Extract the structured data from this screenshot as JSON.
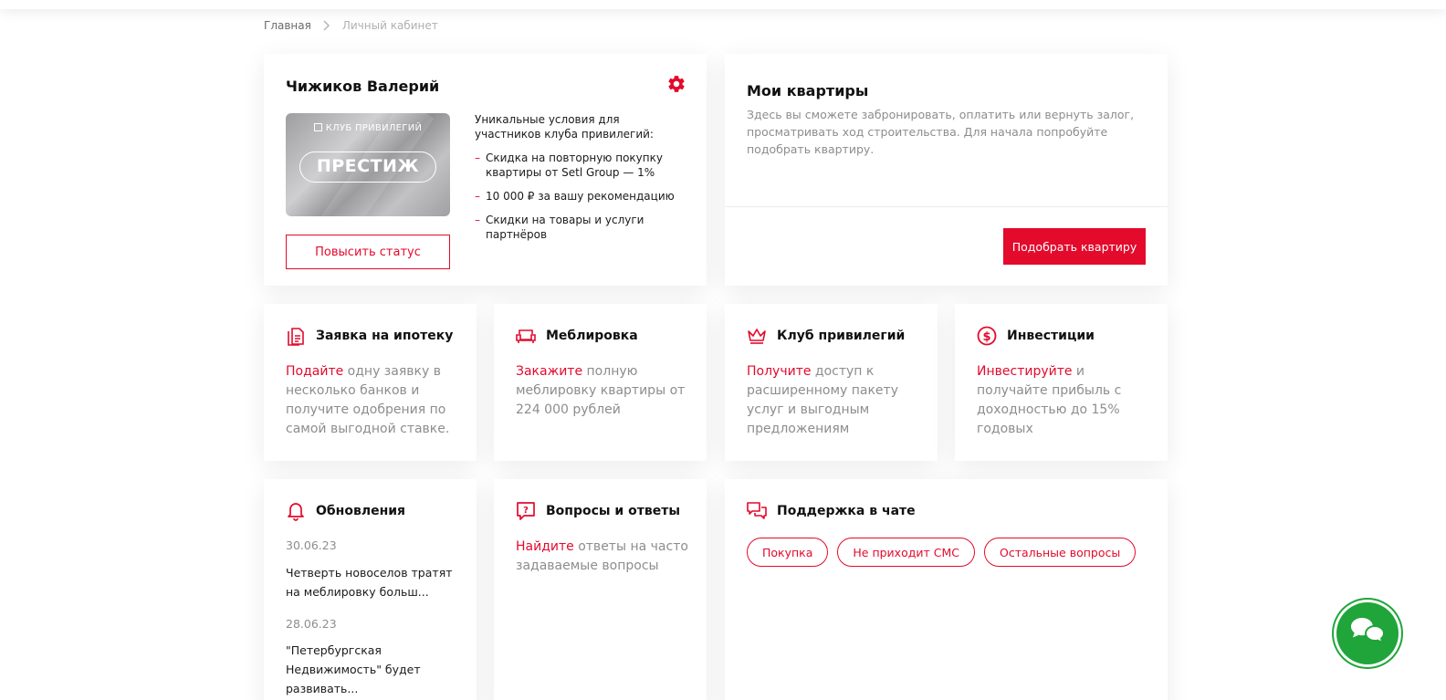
{
  "breadcrumb": {
    "home": "Главная",
    "current": "Личный кабинет"
  },
  "profile": {
    "name": "Чижиков Валерий",
    "card_club": "КЛУБ ПРИВИЛЕГИЙ",
    "card_status": "ПРЕСТИЖ",
    "upgrade_button": "Повысить статус",
    "benefits_intro": "Уникальные условия для участников клуба привилегий:",
    "benefits": [
      "Скидка на повторную покупку квартиры от Setl Group — 1%",
      "10 000 ₽ за вашу рекомендацию",
      "Скидки на товары и услуги партнёров"
    ]
  },
  "apartments": {
    "title": "Мои квартиры",
    "description": "Здесь вы сможете забронировать, оплатить или вернуть залог, просматривать ход строительства. Для начала попробуйте подобрать квартиру.",
    "button": "Подобрать квартиру"
  },
  "services": [
    {
      "title": "Заявка на ипотеку",
      "link": "Подайте",
      "text": " одну заявку в несколько банков и получите одобрения по самой выгодной ставке.",
      "icon": "document-icon"
    },
    {
      "title": "Меблировка",
      "link": "Закажите",
      "text": " полную меблировку квартиры от 224 000 рублей",
      "icon": "sofa-icon"
    },
    {
      "title": "Клуб привилегий",
      "link": "Получите",
      "text": " доступ к расширенному пакету услуг и выгодным предложениям",
      "icon": "crown-icon"
    },
    {
      "title": "Инвестиции",
      "link": "Инвестируйте",
      "text": " и получайте прибыль с доходностью до 15% годовых",
      "icon": "dollar-icon"
    }
  ],
  "updates": {
    "title": "Обновления",
    "items": [
      {
        "date": "30.06.23",
        "text": "Четверть новоселов тратят на меблировку больш..."
      },
      {
        "date": "28.06.23",
        "text": "\"Петербургская Недвижимость\" будет развивать..."
      }
    ]
  },
  "faq": {
    "title": "Вопросы и ответы",
    "link": "Найдите",
    "text": " ответы на часто задаваемые вопросы"
  },
  "support": {
    "title": "Поддержка в чате",
    "chips": [
      "Покупка",
      "Не приходит СМС",
      "Остальные вопросы"
    ]
  },
  "colors": {
    "accent": "#e30a2c",
    "chat_button": "#1fa53a",
    "muted_text": "#8d8d8d"
  }
}
